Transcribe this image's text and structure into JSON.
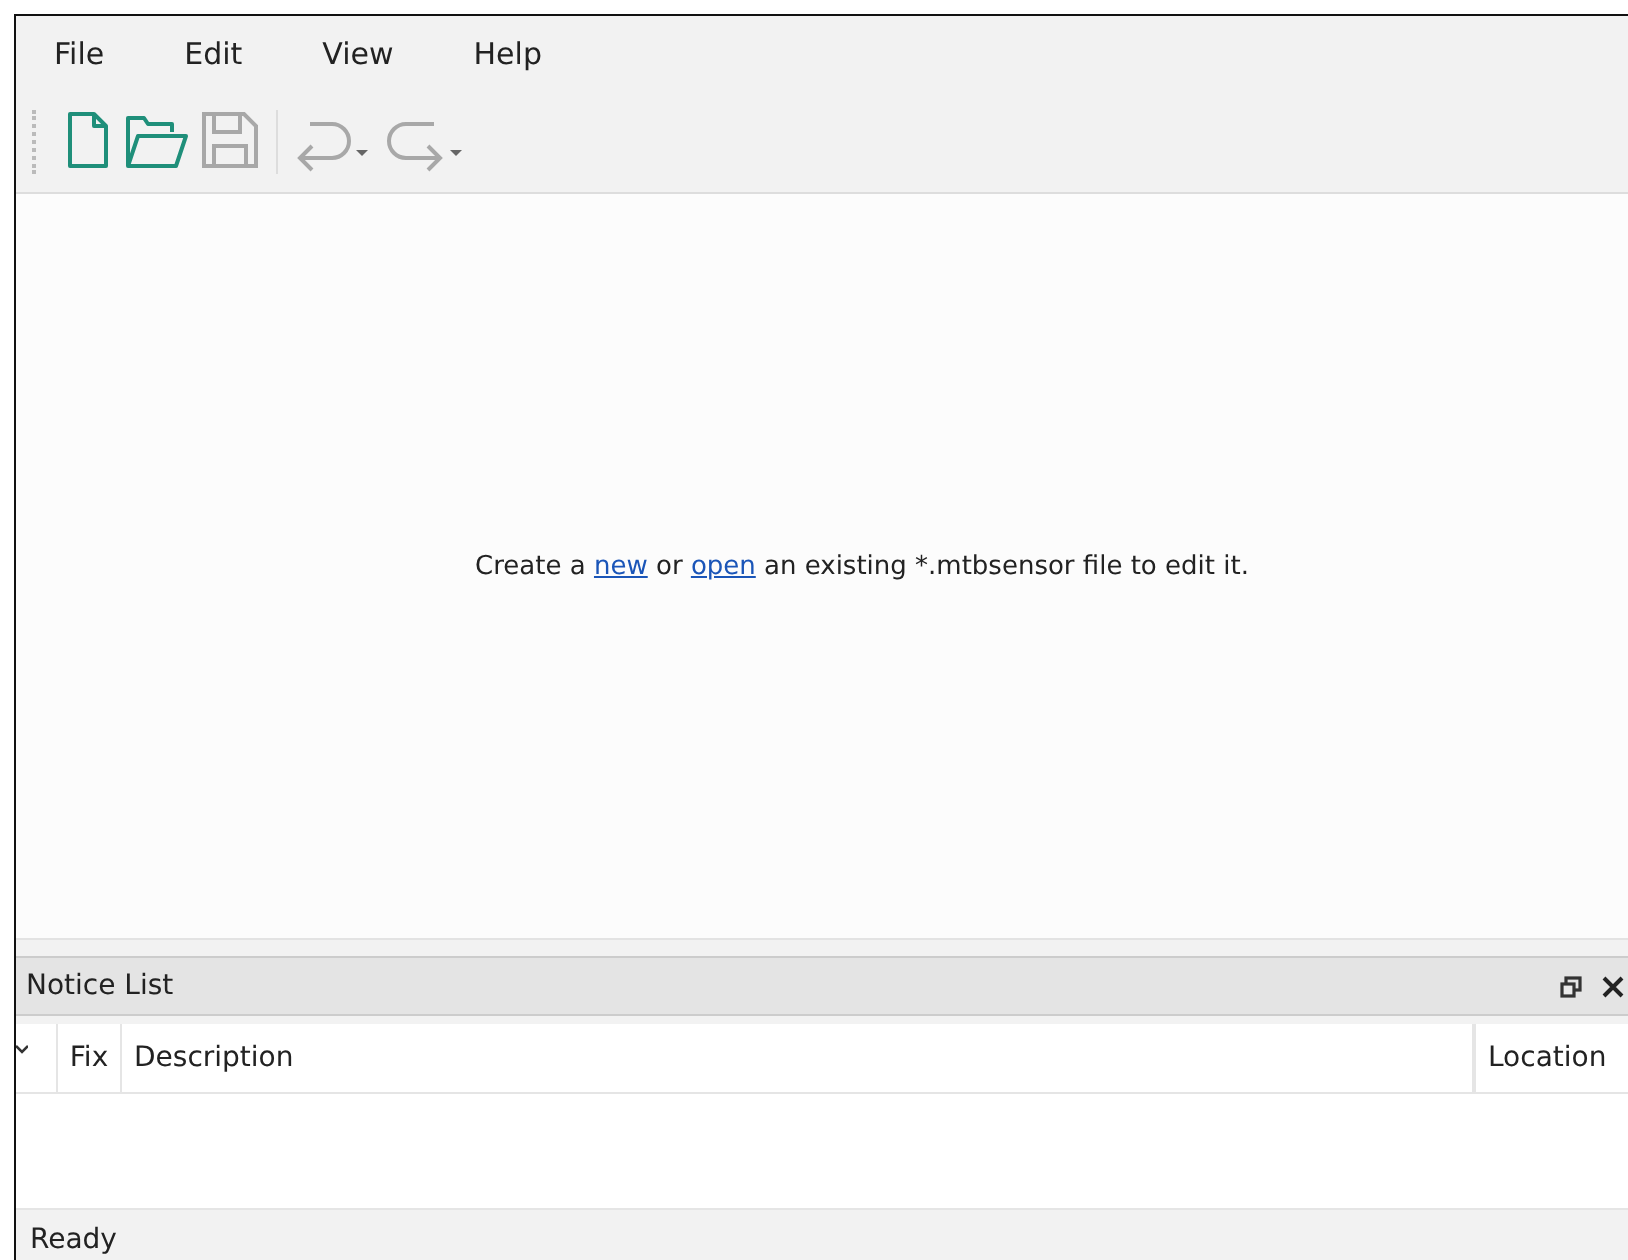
{
  "menu": [
    {
      "label": "File"
    },
    {
      "label": "Edit"
    },
    {
      "label": "View"
    },
    {
      "label": "Help"
    }
  ],
  "toolbar": [
    {
      "kind": "new",
      "disabled": false
    },
    {
      "kind": "open",
      "disabled": false
    },
    {
      "kind": "save",
      "disabled": true
    },
    {
      "kind": "undo",
      "disabled": true
    },
    {
      "kind": "redo",
      "disabled": true
    }
  ],
  "message": [
    {
      "kind": "text",
      "text": "Create a "
    },
    {
      "kind": "link",
      "text": "new"
    },
    {
      "kind": "text",
      "text": " or "
    },
    {
      "kind": "link",
      "text": "open"
    },
    {
      "kind": "text",
      "text": " an existing *.mtbsensor file to edit it."
    }
  ],
  "notice_list": {
    "title": "Notice List",
    "columns": [
      {
        "kind": "sort"
      },
      {
        "kind": "text",
        "label": "Fix"
      },
      {
        "kind": "text",
        "label": "Description"
      },
      {
        "kind": "text",
        "label": "Location"
      }
    ]
  },
  "status_bar": "Ready"
}
